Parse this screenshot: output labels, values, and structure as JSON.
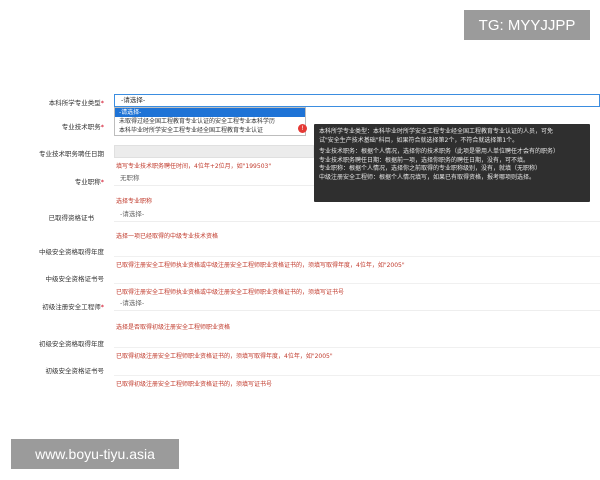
{
  "watermarks": {
    "top": "TG: MYYJJPP",
    "bottom": "www.boyu-tiyu.asia"
  },
  "form": {
    "major_type": {
      "label": "本科所学专业类型",
      "value": "-请选择-",
      "options": [
        "-请选择-",
        "未取得过经全国工程教育专业认证的安全工程专业本科学历",
        "本科毕业时所学安全工程专业经全国工程教育专业认证"
      ]
    },
    "tech_title": {
      "label": "专业技术职务"
    },
    "tech_title_date": {
      "label": "专业技术职务聘任日期",
      "hint": "填写专业技术职务聘任时间，4位年+2位月，如\"199503\""
    },
    "title_name": {
      "label": "专业职称",
      "value": "无职称",
      "hint": "选择专业职称"
    },
    "obtained_cert": {
      "label": "已取得资格证书",
      "value": "-请选择-",
      "hint": "选择一项已经取得的中级专业技术资格"
    },
    "mid_year": {
      "label": "中级安全资格取得年度",
      "hint": "已取得注册安全工程师执业资格或中级注册安全工程师职业资格证书的，须填写取得年度，4位年，如\"2005\""
    },
    "mid_cert_no": {
      "label": "中级安全资格证书号",
      "hint": "已取得注册安全工程师执业资格或中级注册安全工程师职业资格证书的，须填写证书号"
    },
    "junior_engineer": {
      "label": "初级注册安全工程师",
      "value": "-请选择-",
      "hint": "选择是否取得初级注册安全工程师职业资格"
    },
    "junior_year": {
      "label": "初级安全资格取得年度",
      "hint": "已取得初级注册安全工程师职业资格证书的，须填写取得年度，4位年，如\"2005\""
    },
    "junior_cert_no": {
      "label": "初级安全资格证书号",
      "hint": "已取得初级注册安全工程师职业资格证书的，须填写证书号"
    }
  },
  "tooltip": {
    "badge": "!",
    "line1": "本科所学专业类型：本科毕业时所学安全工程专业经全国工程教育专业认证的人员，可免",
    "line2": "试\"安全生产技术基础\"科目，如果符合就选择第2个，不符合就选择第1个。",
    "line3": "专业技术职务：根据个人情况，选择你的技术职务（此项是需用人单位聘任才会有的职务）",
    "line4": "专业技术职务聘任日期：根据前一项，选择你职务的聘任日期，没有，可不填。",
    "line5": "专业职称：根据个人情况，选择你之前取得的专业职称级别，没有，就填（无职称）",
    "line6": "中级注册安全工程师：根据个人情况填写，如果已有取得资格，报考哪项则选择。"
  }
}
